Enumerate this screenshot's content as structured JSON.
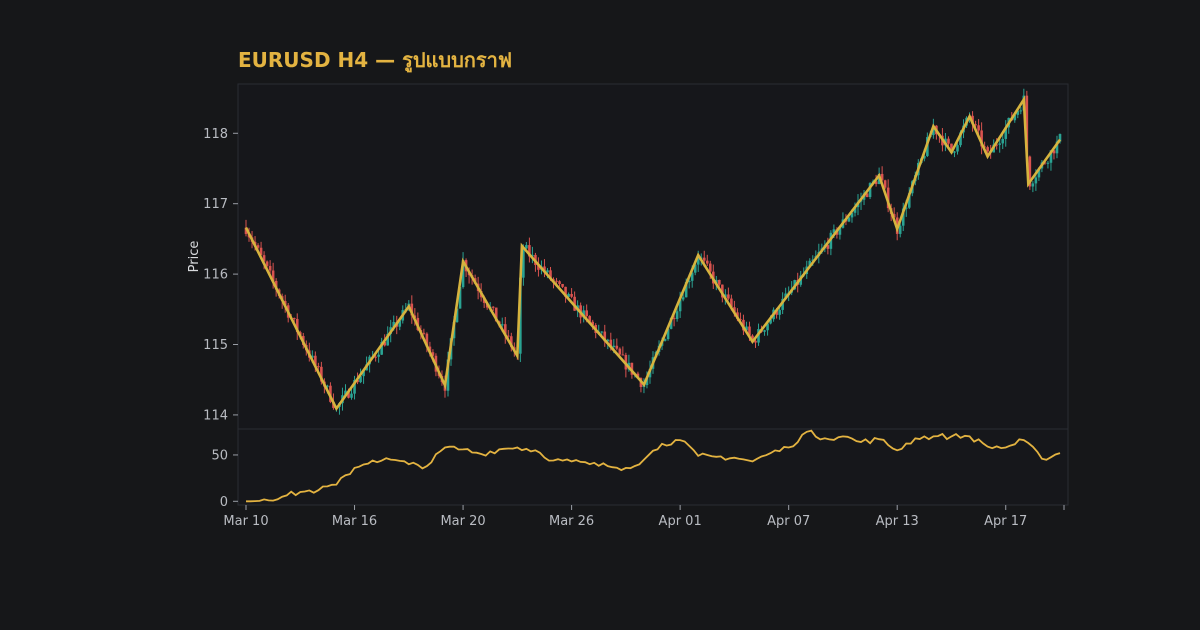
{
  "chart_data": {
    "type": "candlestick",
    "title": "EURUSD H4 — รูปแบบกราฟ",
    "ylabel": "Price",
    "xlabel": "",
    "main_panel": {
      "ylim": [
        113.8,
        118.7
      ],
      "yticks": [
        114,
        115,
        116,
        117,
        118
      ]
    },
    "indicator_panel": {
      "ylim": [
        -4,
        78
      ],
      "yticks": [
        0,
        50
      ]
    },
    "x_range": [
      "2025-03-10",
      "2025-04-24"
    ],
    "x_ticks": [
      {
        "date": "2025-03-10",
        "label": "Mar 10"
      },
      {
        "date": "2025-03-16",
        "label": "Mar 16"
      },
      {
        "date": "2025-03-22",
        "label": "Mar 20"
      },
      {
        "date": "2025-03-28",
        "label": "Mar 26"
      },
      {
        "date": "2025-04-03",
        "label": "Apr 01"
      },
      {
        "date": "2025-04-09",
        "label": "Apr 07"
      },
      {
        "date": "2025-04-15",
        "label": "Apr 13"
      },
      {
        "date": "2025-04-21",
        "label": "Apr 17"
      }
    ],
    "zigzag": [
      [
        "2025-03-10",
        116.66
      ],
      [
        "2025-03-15",
        114.09
      ],
      [
        "2025-03-19",
        115.54
      ],
      [
        "2025-03-21",
        114.42
      ],
      [
        "2025-03-22",
        116.18
      ],
      [
        "2025-03-25",
        114.84
      ],
      [
        "2025-03-25",
        116.4
      ],
      [
        "2025-04-01",
        114.43
      ],
      [
        "2025-04-04",
        116.27
      ],
      [
        "2025-04-07",
        115.04
      ],
      [
        "2025-04-14",
        117.4
      ],
      [
        "2025-04-15",
        116.64
      ],
      [
        "2025-04-17",
        118.1
      ],
      [
        "2025-04-18",
        117.73
      ],
      [
        "2025-04-19",
        118.24
      ],
      [
        "2025-04-20",
        117.67
      ],
      [
        "2025-04-22",
        118.48
      ],
      [
        "2025-04-22",
        117.28
      ],
      [
        "2025-04-24",
        117.91
      ]
    ],
    "zigzag_tail": [
      [
        "2025-04-24",
        117.91
      ]
    ],
    "indicator": [
      [
        "2025-03-10",
        0
      ],
      [
        "2025-03-11",
        2
      ],
      [
        "2025-03-12",
        5
      ],
      [
        "2025-03-13",
        10
      ],
      [
        "2025-03-14",
        12
      ],
      [
        "2025-03-15",
        18
      ],
      [
        "2025-03-16",
        36
      ],
      [
        "2025-03-17",
        44
      ],
      [
        "2025-03-18",
        45
      ],
      [
        "2025-03-19",
        40
      ],
      [
        "2025-03-20",
        38
      ],
      [
        "2025-03-21",
        58
      ],
      [
        "2025-03-22",
        56
      ],
      [
        "2025-03-23",
        51
      ],
      [
        "2025-03-24",
        56
      ],
      [
        "2025-03-25",
        58
      ],
      [
        "2025-03-26",
        55
      ],
      [
        "2025-03-27",
        44
      ],
      [
        "2025-03-28",
        43
      ],
      [
        "2025-03-29",
        40
      ],
      [
        "2025-03-30",
        38
      ],
      [
        "2025-03-31",
        36
      ],
      [
        "2025-04-01",
        45
      ],
      [
        "2025-04-02",
        62
      ],
      [
        "2025-04-03",
        66
      ],
      [
        "2025-04-04",
        49
      ],
      [
        "2025-04-05",
        48
      ],
      [
        "2025-04-06",
        47
      ],
      [
        "2025-04-07",
        43
      ],
      [
        "2025-04-08",
        52
      ],
      [
        "2025-04-09",
        58
      ],
      [
        "2025-04-10",
        75
      ],
      [
        "2025-04-11",
        68
      ],
      [
        "2025-04-12",
        70
      ],
      [
        "2025-04-13",
        64
      ],
      [
        "2025-04-14",
        67
      ],
      [
        "2025-04-15",
        55
      ],
      [
        "2025-04-16",
        68
      ],
      [
        "2025-04-17",
        70
      ],
      [
        "2025-04-18",
        70
      ],
      [
        "2025-04-19",
        70
      ],
      [
        "2025-04-20",
        59
      ],
      [
        "2025-04-21",
        58
      ],
      [
        "2025-04-22",
        66
      ],
      [
        "2025-04-23",
        46
      ],
      [
        "2025-04-24",
        52
      ]
    ],
    "candles_note": "",
    "colors": {
      "background": "#161719",
      "panel": "#16171b",
      "panel_border": "#2a2c33",
      "up": "#2aa393",
      "down": "#d9534f",
      "zigzag": "#d6b33e",
      "indicator": "#e3b341",
      "title": "#e3b341"
    }
  }
}
